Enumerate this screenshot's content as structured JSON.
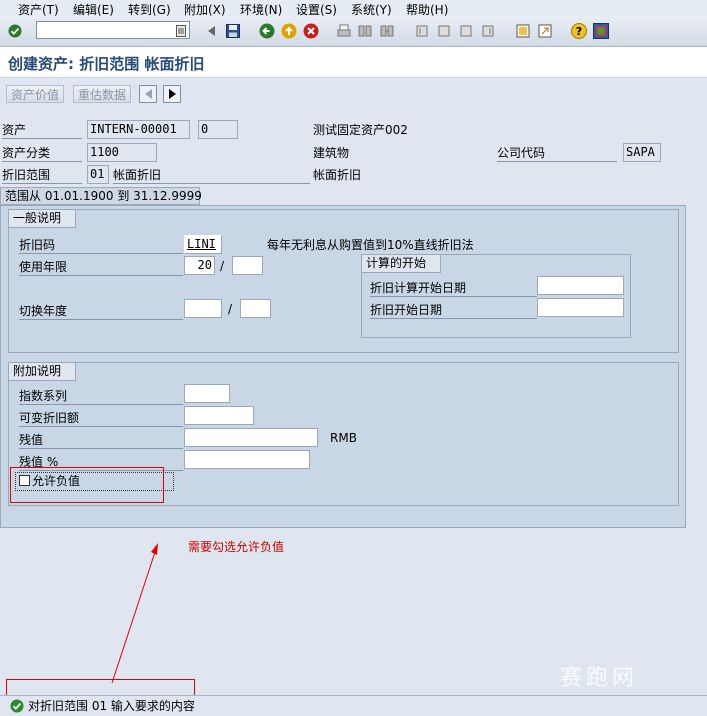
{
  "menu": [
    "资产(T)",
    "编辑(E)",
    "转到(G)",
    "附加(X)",
    "环境(N)",
    "设置(S)",
    "系统(Y)",
    "帮助(H)"
  ],
  "toolbar": {
    "icons": [
      "enter-icon",
      "history-icon",
      "back-icon",
      "save-icon",
      "back-nav-icon",
      "exit-icon",
      "cancel-icon",
      "print-icon",
      "find-icon",
      "find-next-icon",
      "first-page-icon",
      "prev-page-icon",
      "next-page-icon",
      "last-page-icon",
      "new-session-icon",
      "shortcut-icon",
      "help-icon",
      "layout-icon"
    ]
  },
  "title": "创建资产: 折旧范围 帐面折旧",
  "app_toolbar": {
    "asset_value": "资产价值",
    "revaluation": "重估数据"
  },
  "header": {
    "asset_label": "资产",
    "asset_number": "INTERN-00001",
    "asset_sub": "0",
    "asset_desc": "测试固定资产002",
    "class_label": "资产分类",
    "class_value": "1100",
    "class_desc": "建筑物",
    "company_label": "公司代码",
    "company_value": "SAPA",
    "area_label": "折旧范围",
    "area_value": "01",
    "area_desc": "帐面折旧",
    "area_desc2": "帐面折旧"
  },
  "range_tab": "范围从 01.01.1900 到 31.12.9999",
  "general": {
    "header": "一般说明",
    "depkey_label": "折旧码",
    "depkey_value": "LINI",
    "depkey_desc": "每年无利息从购置值到10%直线折旧法",
    "life_label": "使用年限",
    "life_years": "20",
    "life_sep": "/",
    "changeover_label": "切换年度",
    "changeover_sep": "/",
    "calc_start": {
      "header": "计算的开始",
      "ord_dep_start_label": "折旧计算开始日期",
      "dep_start_label": "折旧开始日期"
    }
  },
  "additional": {
    "header": "附加说明",
    "index_label": "指数系列",
    "variable_label": "可变折旧额",
    "scrap_label": "残值",
    "scrap_currency": "RMB",
    "scrap_pct_label": "残值 %",
    "neg_values_label": "允许负值",
    "neg_values_checked": false
  },
  "annotation": "需要勾选允许负值",
  "status": {
    "message": "对折旧范围 01 输入要求的内容"
  },
  "watermark": "赛跑网"
}
